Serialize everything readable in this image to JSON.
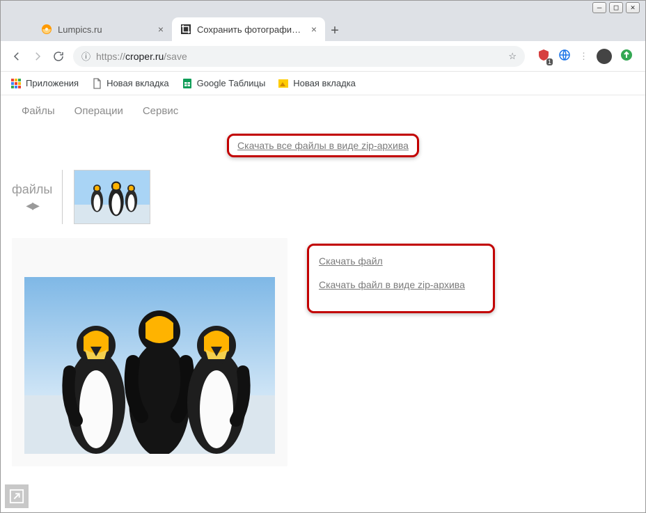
{
  "window": {
    "minimize": "—",
    "maximize": "□",
    "close": "✕"
  },
  "tabs": [
    {
      "title": "Lumpics.ru",
      "active": false
    },
    {
      "title": "Сохранить фотографии - Онлай",
      "active": true
    }
  ],
  "new_tab_label": "+",
  "address": {
    "protocol": "https://",
    "host": "croper.ru",
    "path": "/save",
    "info_glyph": "ⓘ",
    "star_glyph": "☆"
  },
  "bookmarks": [
    {
      "label": "Приложения",
      "icon": "apps"
    },
    {
      "label": "Новая вкладка",
      "icon": "doc"
    },
    {
      "label": "Google Таблицы",
      "icon": "sheets"
    },
    {
      "label": "Новая вкладка",
      "icon": "img"
    }
  ],
  "site_nav": [
    "Файлы",
    "Операции",
    "Сервис"
  ],
  "download_all_label": "Скачать все файлы в виде zip-архива",
  "files_label": "файлы",
  "file_links": {
    "download": "Скачать файл",
    "download_zip": "Скачать файл в виде zip-архива"
  },
  "ext_icons": {
    "evernote_badge": "1"
  }
}
